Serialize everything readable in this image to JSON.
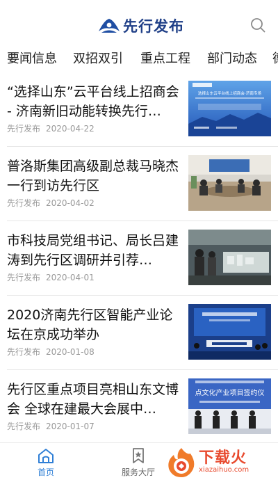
{
  "header": {
    "app_title": "先行发布",
    "logo_icon": "lotus-logo-icon",
    "search_icon": "search-icon"
  },
  "tabs": [
    {
      "label": "要闻信息",
      "active": false
    },
    {
      "label": "双招双引",
      "active": true
    },
    {
      "label": "重点工程",
      "active": false
    },
    {
      "label": "部门动态",
      "active": false
    },
    {
      "label": "德",
      "active": false
    }
  ],
  "news": [
    {
      "title": "“选择山东”云平台线上招商会 - 济南新旧动能转换先行…",
      "source": "先行发布",
      "date": "2020-04-22",
      "thumb_text": "选择山东云平台线上招商会·济南专场"
    },
    {
      "title": "普洛斯集团高级副总裁马晓杰一行到访先行区",
      "source": "先行发布",
      "date": "2020-04-02",
      "thumb_text": ""
    },
    {
      "title": "市科技局党组书记、局长吕建涛到先行区调研并引荐…",
      "source": "先行发布",
      "date": "2020-04-01",
      "thumb_text": ""
    },
    {
      "title": "2020济南先行区智能产业论坛在京成功举办",
      "source": "先行发布",
      "date": "2020-01-08",
      "thumb_text": ""
    },
    {
      "title": "先行区重点项目亮相山东文博会 全球在建最大会展中…",
      "source": "先行发布",
      "date": "2020-01-07",
      "thumb_text": "点文化产业项目签约仪"
    }
  ],
  "bottom_nav": [
    {
      "label": "首页",
      "icon": "home-icon",
      "active": true,
      "color": "#2f7fd6"
    },
    {
      "label": "服务大厅",
      "icon": "bookmark-icon",
      "active": false,
      "color": "#666666"
    }
  ],
  "watermark": {
    "text": "下载火",
    "url": "xiazaihuo.com",
    "color": "#e84a2e"
  }
}
